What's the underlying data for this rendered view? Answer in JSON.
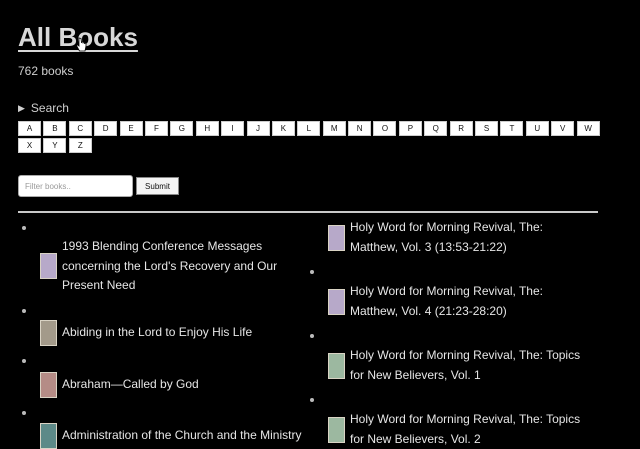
{
  "page": {
    "title": "All Books",
    "count": "762 books"
  },
  "search": {
    "toggle_label": "Search"
  },
  "letters": [
    "A",
    "B",
    "C",
    "D",
    "E",
    "F",
    "G",
    "H",
    "I",
    "J",
    "K",
    "L",
    "M",
    "N",
    "O",
    "P",
    "Q",
    "R",
    "S",
    "T",
    "U",
    "V",
    "W",
    "X",
    "Y",
    "Z"
  ],
  "filter": {
    "placeholder": "Filter books..",
    "submit_label": "Submit"
  },
  "books_left": [
    {
      "title": "1993 Blending Conference Messages concerning the Lord's Recovery and Our Present Need"
    },
    {
      "title": "Abiding in the Lord to Enjoy His Life"
    },
    {
      "title": "Abraham—Called by God"
    },
    {
      "title": "Administration of the Church and the Ministry"
    }
  ],
  "books_right": [
    {
      "title": "Holy Word for Morning Revival, The: Matthew, Vol. 3 (13:53-21:22)"
    },
    {
      "title": "Holy Word for Morning Revival, The: Matthew, Vol. 4 (21:23-28:20)"
    },
    {
      "title": "Holy Word for Morning Revival, The: Topics for New Believers, Vol. 1"
    },
    {
      "title": "Holy Word for Morning Revival, The: Topics for New Believers, Vol. 2"
    }
  ],
  "icons": {
    "cursor": "hand-pointer-icon",
    "search_toggle": "triangle-right-icon"
  }
}
